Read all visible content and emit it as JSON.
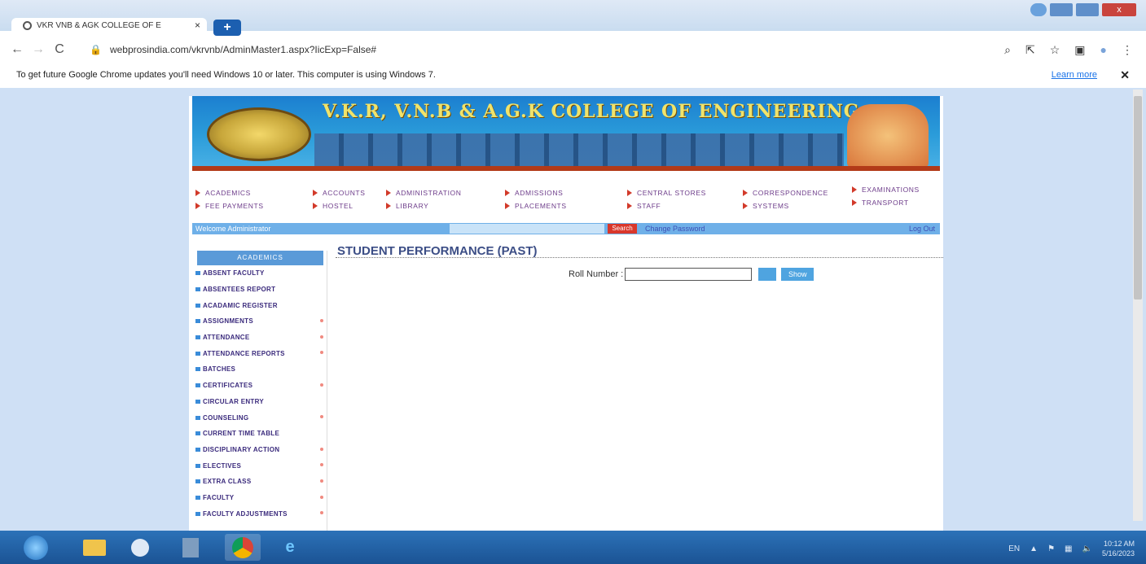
{
  "browser": {
    "tab_title": "VKR VNB & AGK COLLEGE OF E",
    "tab_close": "×",
    "new_tab": "+",
    "url": "webprosindia.com/vkrvnb/AdminMaster1.aspx?IicExp=False#",
    "window_close": "x",
    "info_text": "To get future Google Chrome updates you'll need Windows 10 or later. This computer is using Windows 7.",
    "learn_more": "Learn more",
    "info_close": "✕"
  },
  "site": {
    "college_name": "V.K.R, V.N.B & A.G.K COLLEGE OF ENGINEERING"
  },
  "menu": [
    {
      "label": "ACADEMICS"
    },
    {
      "label": "FEE PAYMENTS"
    },
    {
      "label": "ACCOUNTS"
    },
    {
      "label": "HOSTEL"
    },
    {
      "label": "ADMINISTRATION"
    },
    {
      "label": "LIBRARY"
    },
    {
      "label": "ADMISSIONS"
    },
    {
      "label": "PLACEMENTS"
    },
    {
      "label": "CENTRAL STORES"
    },
    {
      "label": "STAFF"
    },
    {
      "label": "CORRESPONDENCE"
    },
    {
      "label": "SYSTEMS"
    },
    {
      "label": "EXAMINATIONS"
    },
    {
      "label": "TRANSPORT"
    }
  ],
  "welcome": {
    "text": "Welcome Administrator",
    "search_label": "Search",
    "change_password": "Change Password",
    "logout": "Log Out"
  },
  "sidebar": {
    "header": "ACADEMICS",
    "items": [
      {
        "label": "ABSENT FACULTY",
        "has_sub": false
      },
      {
        "label": "ABSENTEES REPORT",
        "has_sub": false
      },
      {
        "label": "ACADAMIC REGISTER",
        "has_sub": false
      },
      {
        "label": "ASSIGNMENTS",
        "has_sub": true
      },
      {
        "label": "ATTENDANCE",
        "has_sub": true
      },
      {
        "label": "ATTENDANCE REPORTS",
        "has_sub": true
      },
      {
        "label": "BATCHES",
        "has_sub": false
      },
      {
        "label": "CERTIFICATES",
        "has_sub": true
      },
      {
        "label": "CIRCULAR ENTRY",
        "has_sub": false
      },
      {
        "label": "COUNSELING",
        "has_sub": true
      },
      {
        "label": "CURRENT TIME TABLE",
        "has_sub": false
      },
      {
        "label": "DISCIPLINARY ACTION",
        "has_sub": true
      },
      {
        "label": "ELECTIVES",
        "has_sub": true
      },
      {
        "label": "EXTRA CLASS",
        "has_sub": true
      },
      {
        "label": "FACULTY",
        "has_sub": true
      },
      {
        "label": "FACULTY ADJUSTMENTS",
        "has_sub": true
      }
    ]
  },
  "main": {
    "title": "STUDENT PERFORMANCE (PAST)",
    "roll_label": "Roll Number :",
    "roll_value": "",
    "show_button": "Show"
  },
  "taskbar": {
    "lang": "EN",
    "time": "10:12 AM",
    "date": "5/16/2023"
  }
}
